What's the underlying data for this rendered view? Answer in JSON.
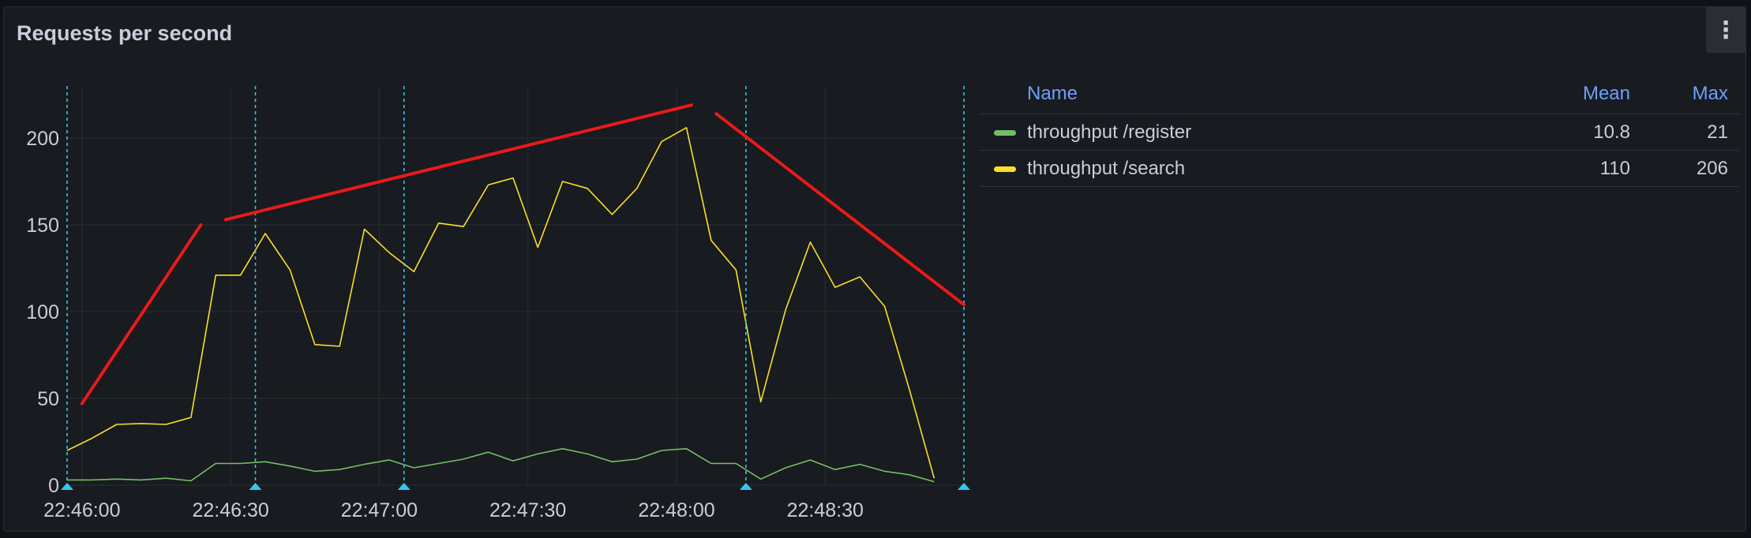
{
  "panel": {
    "title": "Requests per second",
    "menu_icon": "kebab-menu-icon"
  },
  "legend": {
    "headers": {
      "name": "Name",
      "mean": "Mean",
      "max": "Max"
    },
    "rows": [
      {
        "name": "throughput /register",
        "mean": "10.8",
        "max": "21",
        "color": "#73bf69"
      },
      {
        "name": "throughput /search",
        "mean": "110",
        "max": "206",
        "color": "#fade2a"
      }
    ]
  },
  "chart_data": {
    "type": "line",
    "title": "Requests per second",
    "xlabel": "",
    "ylabel": "",
    "x_ticks": [
      "22:46:00",
      "22:46:30",
      "22:47:00",
      "22:47:30",
      "22:48:00",
      "22:48:30"
    ],
    "y_ticks": [
      "0",
      "50",
      "100",
      "150",
      "200"
    ],
    "ylim": [
      0,
      230
    ],
    "x_start": "22:45:57",
    "x_end": "22:48:58",
    "grid": true,
    "series": [
      {
        "name": "throughput /register",
        "color": "#73bf69",
        "points": [
          [
            "22:45:57",
            3
          ],
          [
            "22:46:02",
            3
          ],
          [
            "22:46:07",
            3.5
          ],
          [
            "22:46:12",
            3
          ],
          [
            "22:46:17",
            4
          ],
          [
            "22:46:22",
            2.5
          ],
          [
            "22:46:27",
            12.5
          ],
          [
            "22:46:32",
            12.5
          ],
          [
            "22:46:37",
            13.5
          ],
          [
            "22:46:42",
            11
          ],
          [
            "22:46:47",
            8
          ],
          [
            "22:46:52",
            9
          ],
          [
            "22:46:57",
            12
          ],
          [
            "22:47:02",
            14.5
          ],
          [
            "22:47:07",
            10
          ],
          [
            "22:47:12",
            12.5
          ],
          [
            "22:47:17",
            15
          ],
          [
            "22:47:22",
            19
          ],
          [
            "22:47:27",
            14
          ],
          [
            "22:47:32",
            18
          ],
          [
            "22:47:37",
            21
          ],
          [
            "22:47:42",
            18
          ],
          [
            "22:47:47",
            13.5
          ],
          [
            "22:47:52",
            15
          ],
          [
            "22:47:57",
            20
          ],
          [
            "22:48:02",
            21
          ],
          [
            "22:48:07",
            12.5
          ],
          [
            "22:48:12",
            12.5
          ],
          [
            "22:48:17",
            3.5
          ],
          [
            "22:48:22",
            10
          ],
          [
            "22:48:27",
            14.5
          ],
          [
            "22:48:32",
            9
          ],
          [
            "22:48:37",
            12
          ],
          [
            "22:48:42",
            8
          ],
          [
            "22:48:47",
            6
          ],
          [
            "22:48:52",
            2
          ]
        ]
      },
      {
        "name": "throughput /search",
        "color": "#fade2a",
        "points": [
          [
            "22:45:57",
            20
          ],
          [
            "22:46:02",
            27
          ],
          [
            "22:46:07",
            35
          ],
          [
            "22:46:12",
            35.5
          ],
          [
            "22:46:17",
            35
          ],
          [
            "22:46:22",
            39
          ],
          [
            "22:46:27",
            121
          ],
          [
            "22:46:32",
            121
          ],
          [
            "22:46:37",
            145
          ],
          [
            "22:46:42",
            124
          ],
          [
            "22:46:47",
            81
          ],
          [
            "22:46:52",
            80
          ],
          [
            "22:46:57",
            147.5
          ],
          [
            "22:47:02",
            134
          ],
          [
            "22:47:07",
            123
          ],
          [
            "22:47:12",
            151
          ],
          [
            "22:47:17",
            149
          ],
          [
            "22:47:22",
            173
          ],
          [
            "22:47:27",
            177
          ],
          [
            "22:47:32",
            137
          ],
          [
            "22:47:37",
            175
          ],
          [
            "22:47:42",
            171
          ],
          [
            "22:47:47",
            156
          ],
          [
            "22:47:52",
            171
          ],
          [
            "22:47:57",
            198
          ],
          [
            "22:48:02",
            206
          ],
          [
            "22:48:07",
            141
          ],
          [
            "22:48:12",
            124
          ],
          [
            "22:48:17",
            48
          ],
          [
            "22:48:22",
            101
          ],
          [
            "22:48:27",
            140
          ],
          [
            "22:48:32",
            114
          ],
          [
            "22:48:37",
            120
          ],
          [
            "22:48:42",
            103
          ],
          [
            "22:48:47",
            55
          ],
          [
            "22:48:52",
            4
          ]
        ]
      }
    ],
    "annotations": {
      "color": "#33c6f0",
      "times": [
        "22:45:57",
        "22:46:35",
        "22:47:05",
        "22:48:14",
        "22:48:58"
      ]
    },
    "overlay_lines": {
      "color": "#e81a1a",
      "segments": [
        {
          "from": [
            "22:46:00",
            47
          ],
          "to": [
            "22:46:24",
            150
          ]
        },
        {
          "from": [
            "22:46:29",
            153
          ],
          "to": [
            "22:48:03",
            219
          ]
        },
        {
          "from": [
            "22:48:08",
            214
          ],
          "to": [
            "22:48:58",
            104
          ]
        }
      ]
    }
  }
}
